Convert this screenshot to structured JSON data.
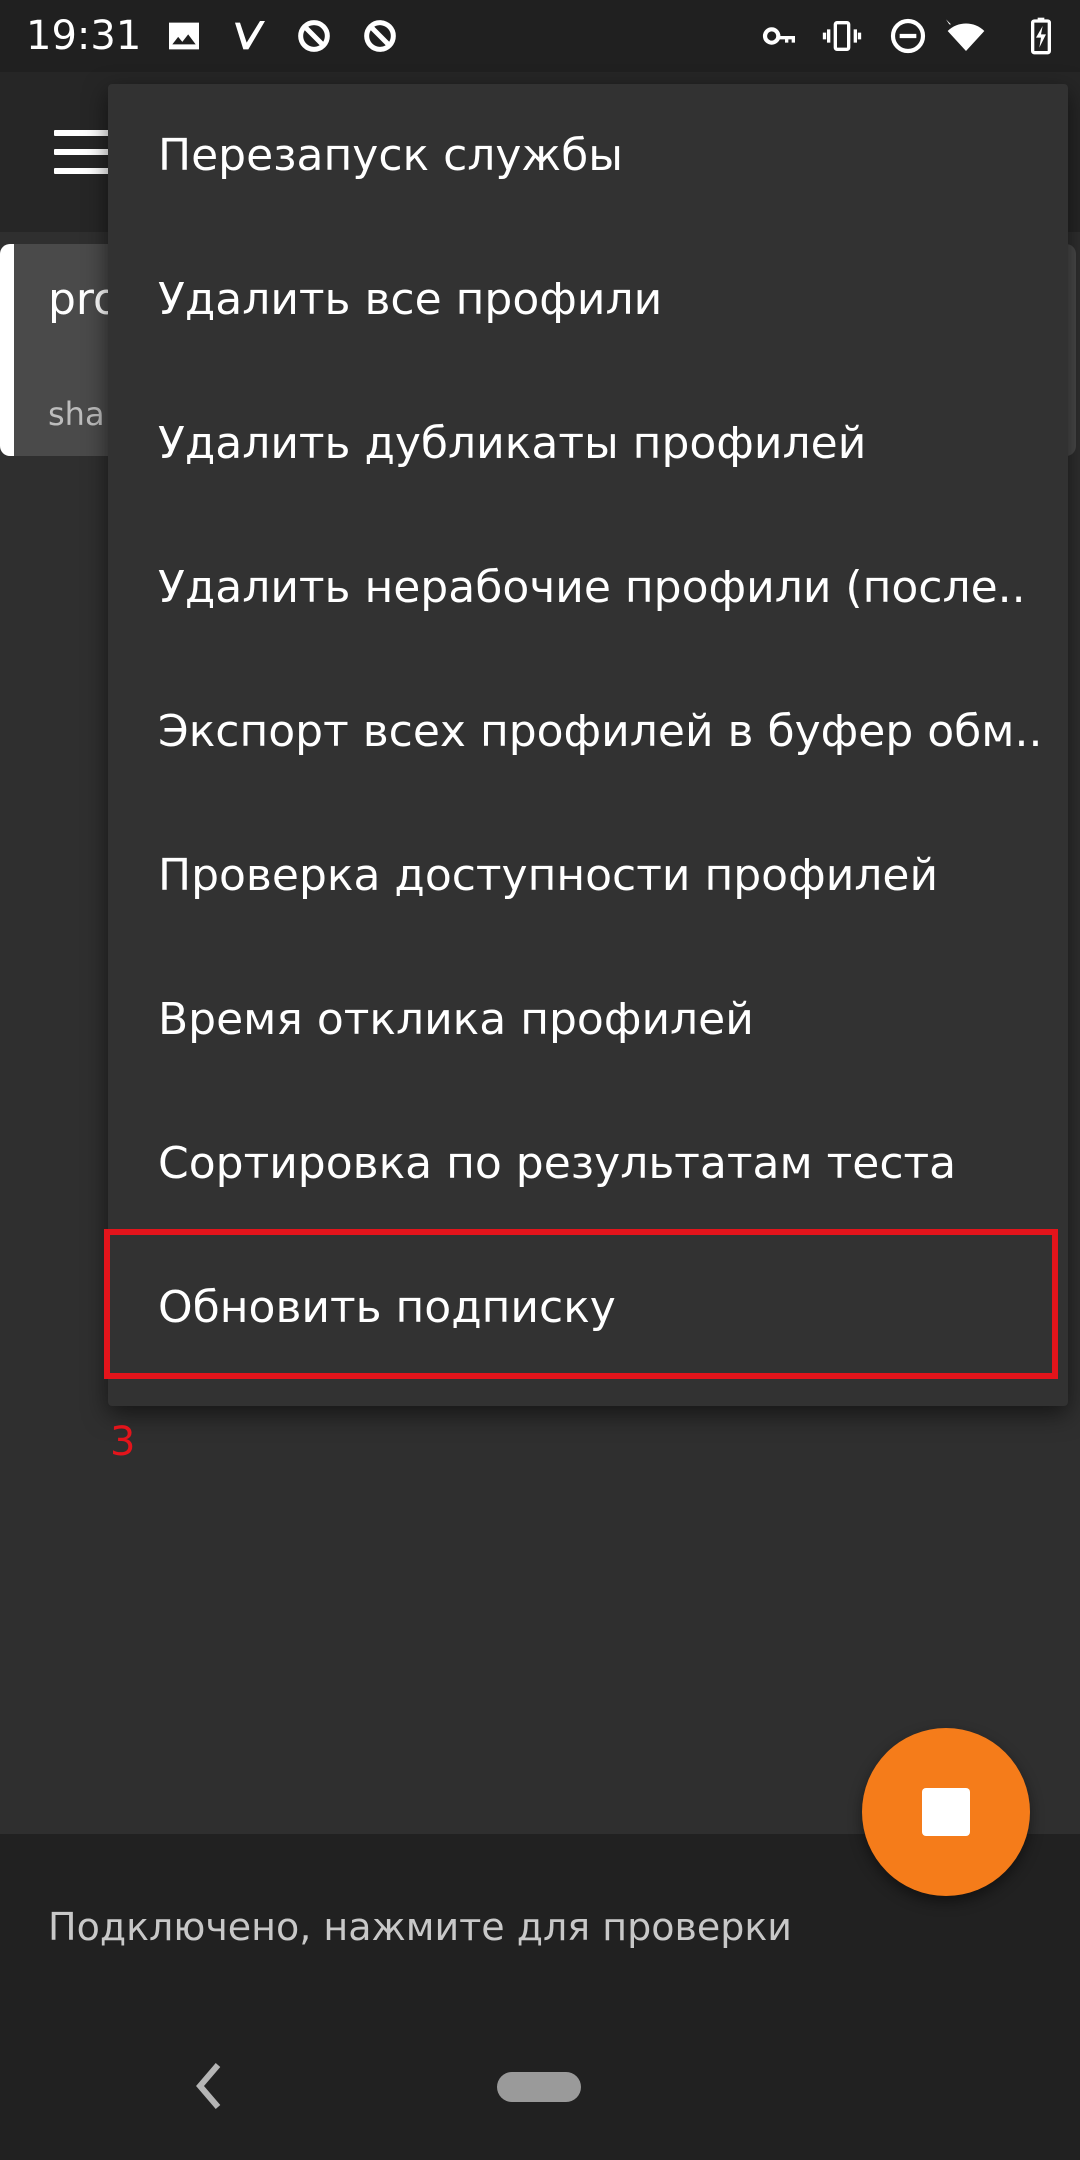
{
  "status_bar": {
    "time": "19:31",
    "icons": [
      "image-icon",
      "v-app-icon",
      "circle-slash-icon",
      "circle-slash-icon",
      "vpn-key-icon",
      "vibrate-icon",
      "do-not-disturb-icon",
      "wifi-icon",
      "battery-charging-icon"
    ]
  },
  "toolbar": {
    "menu_icon": "hamburger-menu-icon"
  },
  "profile_card": {
    "name": "pro",
    "type": "sha"
  },
  "overflow_menu": {
    "items": [
      {
        "label": "Перезапуск службы"
      },
      {
        "label": "Удалить все профили"
      },
      {
        "label": "Удалить дубликаты профилей"
      },
      {
        "label": "Удалить нерабочие профили (после.."
      },
      {
        "label": "Экспорт всех профилей в буфер обм.."
      },
      {
        "label": "Проверка доступности профилей"
      },
      {
        "label": "Время отклика профилей"
      },
      {
        "label": "Сортировка по результатам теста"
      },
      {
        "label": "Обновить подписку"
      }
    ]
  },
  "annotation": {
    "number": "3",
    "color": "#e3141b"
  },
  "bottom": {
    "status_text": "Подключено, нажмите для проверки"
  },
  "fab": {
    "icon": "stop-icon",
    "color": "#f57c1a"
  },
  "nav": {
    "back_icon": "back-chevron-icon",
    "home_icon": "home-pill-icon"
  }
}
